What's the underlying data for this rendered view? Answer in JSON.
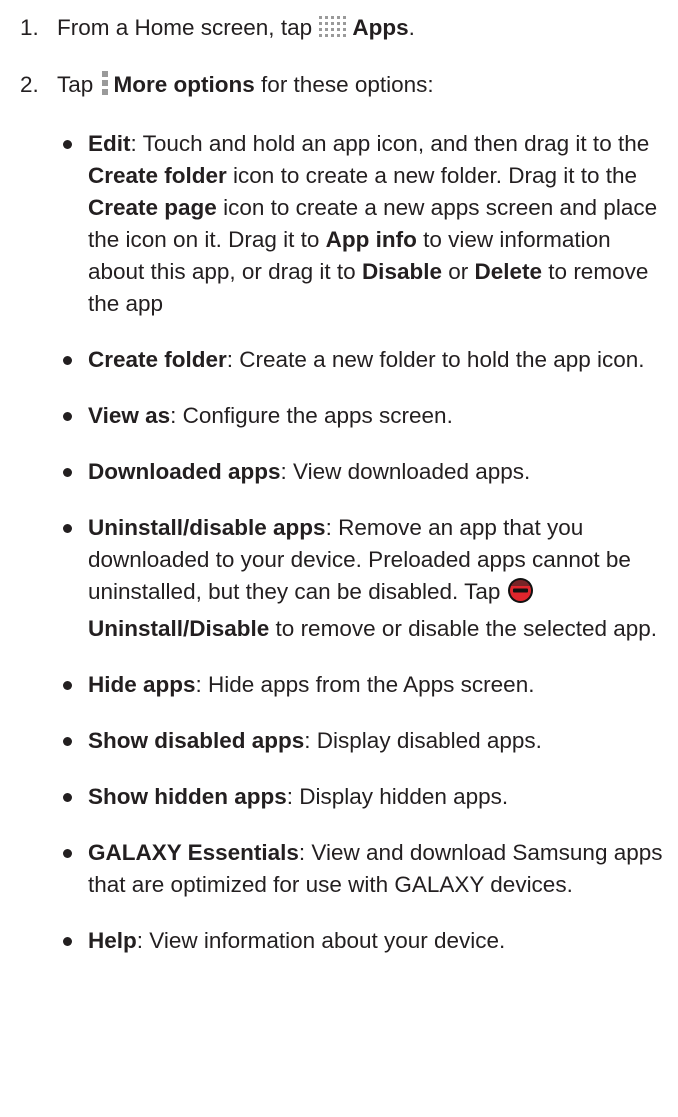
{
  "step1": {
    "number": "1.",
    "before": "From a Home screen, tap",
    "bold": "Apps",
    "after": ".",
    "icon": "apps-grid-icon"
  },
  "step2": {
    "number": "2.",
    "before": "Tap",
    "bold": "More options",
    "after": " for these options:",
    "icon": "more-options-icon"
  },
  "bullets": [
    {
      "segments": [
        {
          "b": true,
          "t": "Edit"
        },
        {
          "t": ": Touch and hold an app icon, and then drag it to the "
        },
        {
          "b": true,
          "t": "Create folder"
        },
        {
          "t": " icon to create a new folder. Drag it to the "
        },
        {
          "b": true,
          "t": "Create page"
        },
        {
          "t": " icon to create a new apps screen and place the icon on it. Drag it to "
        },
        {
          "b": true,
          "t": "App info"
        },
        {
          "t": " to view information about this app, or drag it to "
        },
        {
          "b": true,
          "t": "Disable"
        },
        {
          "t": " or "
        },
        {
          "b": true,
          "t": "Delete"
        },
        {
          "t": " to remove the app"
        }
      ]
    },
    {
      "segments": [
        {
          "b": true,
          "t": "Create folder"
        },
        {
          "t": ": Create a new folder to hold the app icon."
        }
      ]
    },
    {
      "segments": [
        {
          "b": true,
          "t": "View as"
        },
        {
          "t": ": Configure the apps screen."
        }
      ]
    },
    {
      "segments": [
        {
          "b": true,
          "t": "Downloaded apps"
        },
        {
          "t": ": View downloaded apps."
        }
      ]
    },
    {
      "segments": [
        {
          "b": true,
          "t": "Uninstall/disable apps"
        },
        {
          "t": ": Remove an app that you downloaded to your device. Preloaded apps cannot be uninstalled, but they can be disabled. Tap "
        },
        {
          "icon": "uninstall-disable-icon"
        },
        {
          "b": true,
          "t": "Uninstall/Disable"
        },
        {
          "t": " to remove or disable the selected app."
        }
      ]
    },
    {
      "segments": [
        {
          "b": true,
          "t": "Hide apps"
        },
        {
          "t": ": Hide apps from the Apps screen."
        }
      ]
    },
    {
      "segments": [
        {
          "b": true,
          "t": "Show disabled apps"
        },
        {
          "t": ": Display disabled apps."
        }
      ]
    },
    {
      "segments": [
        {
          "b": true,
          "t": "Show hidden apps"
        },
        {
          "t": ": Display hidden apps."
        }
      ]
    },
    {
      "segments": [
        {
          "b": true,
          "t": "GALAXY Essentials"
        },
        {
          "t": ": View and download Samsung apps that are optimized for use with GALAXY devices."
        }
      ]
    },
    {
      "segments": [
        {
          "b": true,
          "t": "Help"
        },
        {
          "t": ": View information about your device."
        }
      ]
    }
  ]
}
